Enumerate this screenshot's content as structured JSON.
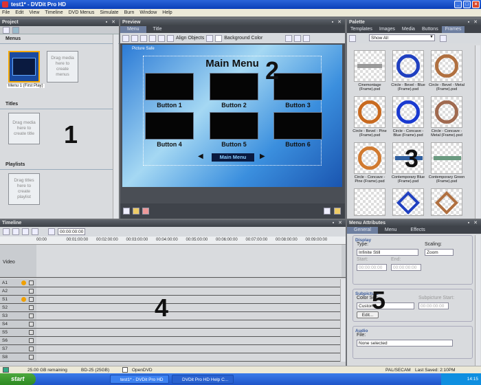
{
  "window": {
    "title": "test1* - DVDit Pro HD"
  },
  "menubar": [
    "File",
    "Edit",
    "View",
    "Timeline",
    "DVD Menus",
    "Simulate",
    "Burn",
    "Window",
    "Help"
  ],
  "project": {
    "title": "Project",
    "menus_label": "Menus",
    "menu1_caption": "Menu 1 (First Play)",
    "menus_drop": "Drag media here to create menus",
    "titles_label": "Titles",
    "titles_drop": "Drag media here to create title",
    "playlists_label": "Playlists",
    "playlists_drop": "Drag titles here to create playlist"
  },
  "preview": {
    "title": "Preview",
    "tabs": [
      "Menu",
      "Title"
    ],
    "align_label": "Align Objects",
    "bg_color_label": "Background Color",
    "safe_label": "Picture Safe",
    "menu_title": "Main Menu",
    "buttons": [
      "Button 1",
      "Button 2",
      "Button 3",
      "Button 4",
      "Button 5",
      "Button 6"
    ],
    "nav_label": "Main Menu"
  },
  "palette": {
    "title": "Palette",
    "tabs": [
      "Templates",
      "Images",
      "Media",
      "Buttons",
      "Frames"
    ],
    "filter": "Show All",
    "items": [
      "Cinemontage (Frame).psd",
      "Circle - Bevel - Blue (Frame).psd",
      "Circle - Bevel - Metal (Frame).psd",
      "Circle - Bevel - Pine (Frame).psd",
      "Circle - Concave - Blue (Frame).psd",
      "Circle - Concave - Metal (Frame).psd",
      "Circle - Concave - Pine (Frame).psd",
      "Contemporary Blue (Frame).psd",
      "Contemporary Green (Frame).psd"
    ],
    "colors": [
      "#888888",
      "#2040c0",
      "#b07040",
      "#c86a20",
      "#1a3ad0",
      "#a06a50",
      "#d07a30",
      "#3060a0",
      "#6a9a80"
    ]
  },
  "timeline": {
    "title": "Timeline",
    "timecode": "00:00:00:00",
    "ticks": [
      "00:00",
      "00:01:00:00",
      "00:02:00:00",
      "00:03:00:00",
      "00:04:00:00",
      "00:05:00:00",
      "00:06:00:00",
      "00:07:00:00",
      "00:08:00:00",
      "00:09:00:00"
    ],
    "video_label": "Video",
    "tracks": [
      "A1",
      "A2",
      "S1",
      "S2",
      "S3",
      "S4",
      "S5",
      "S6",
      "S7",
      "S8"
    ]
  },
  "attributes": {
    "title": "Menu Attributes",
    "tabs": [
      "General",
      "Menu",
      "Effects"
    ],
    "display_label": "Display",
    "type_label": "Type:",
    "type_value": "Infinite Still",
    "scaling_label": "Scaling:",
    "scaling_value": "Zoom",
    "start_label": "Start:",
    "end_label": "End:",
    "tc_blank": "00:00:00:00",
    "subpicture_label": "Subpicture",
    "colorset_label": "Color Set:",
    "colorset_value": "Custom",
    "subpic_start_label": "Subpicture Start:",
    "edit_label": "Edit...",
    "audio_label": "Audio",
    "file_label": "File:",
    "file_value": "None selected"
  },
  "status": {
    "space": "25.00 GB remaining",
    "disc": "BD-25 (25GB)",
    "opendvd": "OpenDVD",
    "standard": "PAL/SECAM",
    "saved": "Last Saved: 2:10PM"
  },
  "taskbar": {
    "start": "start",
    "tasks": [
      "test1* - DVDit Pro HD",
      "DVDit Pro HD Help C..."
    ],
    "clock": "14:15"
  },
  "callouts": [
    "1",
    "2",
    "3",
    "4",
    "5"
  ]
}
